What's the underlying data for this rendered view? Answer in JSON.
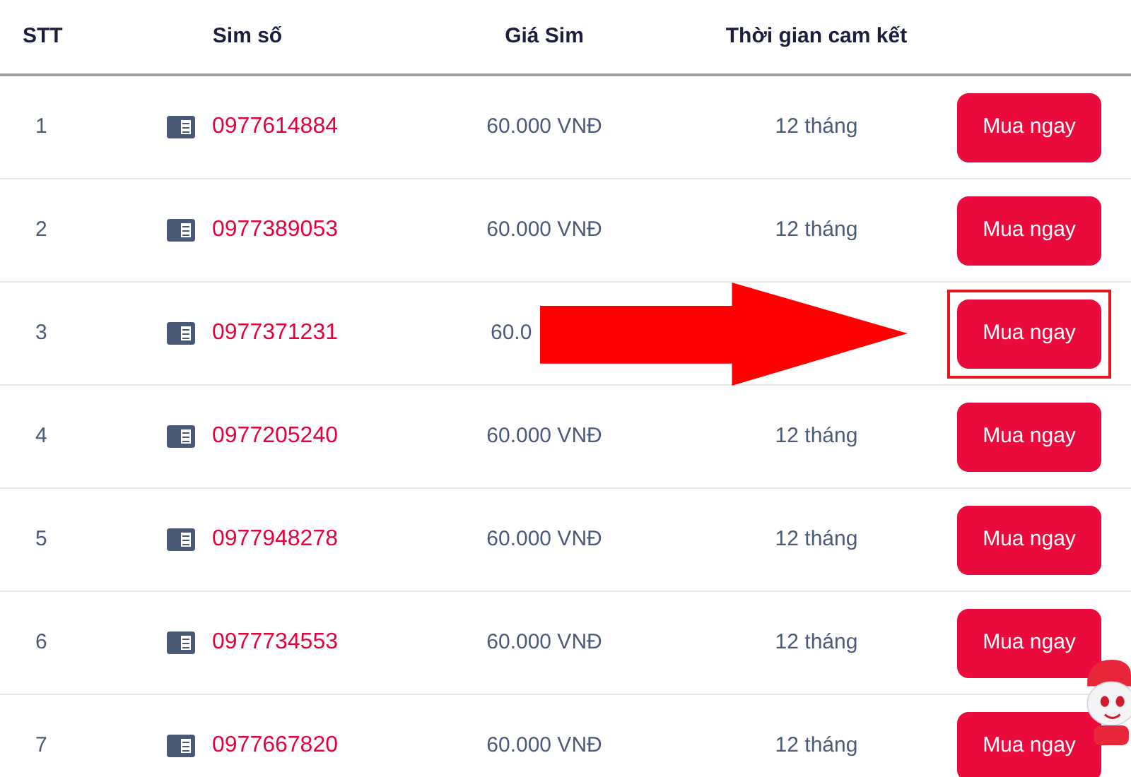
{
  "table": {
    "columns": [
      "STT",
      "Sim số",
      "Giá Sim",
      "Thời gian cam kết"
    ],
    "rows": [
      {
        "index": "1",
        "number": "0977614884",
        "price": "60.000 VNĐ",
        "term": "12 tháng",
        "button": "Mua ngay",
        "highlighted": false
      },
      {
        "index": "2",
        "number": "0977389053",
        "price": "60.000 VNĐ",
        "term": "12 tháng",
        "button": "Mua ngay",
        "highlighted": false
      },
      {
        "index": "3",
        "number": "0977371231",
        "price": "60.0",
        "button": "Mua ngay",
        "highlighted": true,
        "arrow": true
      },
      {
        "index": "4",
        "number": "0977205240",
        "price": "60.000 VNĐ",
        "term": "12 tháng",
        "button": "Mua ngay",
        "highlighted": false
      },
      {
        "index": "5",
        "number": "0977948278",
        "price": "60.000 VNĐ",
        "term": "12 tháng",
        "button": "Mua ngay",
        "highlighted": false
      },
      {
        "index": "6",
        "number": "0977734553",
        "price": "60.000 VNĐ",
        "term": "12 tháng",
        "button": "Mua ngay",
        "highlighted": false
      },
      {
        "index": "7",
        "number": "0977667820",
        "price": "60.000 VNĐ",
        "term": "12 tháng",
        "button": "Mua ngay",
        "highlighted": false
      }
    ]
  }
}
